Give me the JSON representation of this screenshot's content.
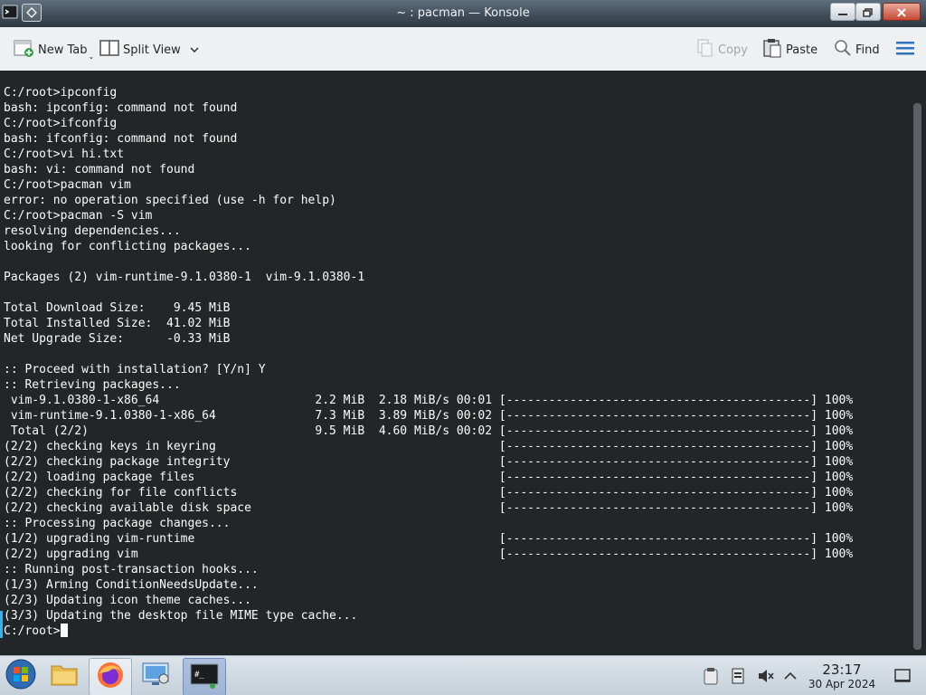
{
  "window": {
    "title": "~ : pacman — Konsole"
  },
  "toolbar": {
    "new_tab": "New Tab",
    "split_view": "Split View",
    "copy": "Copy",
    "paste": "Paste",
    "find": "Find"
  },
  "terminal": {
    "text": "C:/root>ipconfig\nbash: ipconfig: command not found\nC:/root>ifconfig\nbash: ifconfig: command not found\nC:/root>vi hi.txt\nbash: vi: command not found\nC:/root>pacman vim\nerror: no operation specified (use -h for help)\nC:/root>pacman -S vim\nresolving dependencies...\nlooking for conflicting packages...\n\nPackages (2) vim-runtime-9.1.0380-1  vim-9.1.0380-1\n\nTotal Download Size:    9.45 MiB\nTotal Installed Size:  41.02 MiB\nNet Upgrade Size:      -0.33 MiB\n\n:: Proceed with installation? [Y/n] Y\n:: Retrieving packages...\n vim-9.1.0380-1-x86_64                      2.2 MiB  2.18 MiB/s 00:01 [-------------------------------------------] 100%\n vim-runtime-9.1.0380-1-x86_64              7.3 MiB  3.89 MiB/s 00:02 [-------------------------------------------] 100%\n Total (2/2)                                9.5 MiB  4.60 MiB/s 00:02 [-------------------------------------------] 100%\n(2/2) checking keys in keyring                                        [-------------------------------------------] 100%\n(2/2) checking package integrity                                      [-------------------------------------------] 100%\n(2/2) loading package files                                           [-------------------------------------------] 100%\n(2/2) checking for file conflicts                                     [-------------------------------------------] 100%\n(2/2) checking available disk space                                   [-------------------------------------------] 100%\n:: Processing package changes...\n(1/2) upgrading vim-runtime                                           [-------------------------------------------] 100%\n(2/2) upgrading vim                                                   [-------------------------------------------] 100%\n:: Running post-transaction hooks...\n(1/3) Arming ConditionNeedsUpdate...\n(2/3) Updating icon theme caches...\n(3/3) Updating the desktop file MIME type cache...",
    "prompt": "C:/root>"
  },
  "taskbar": {
    "time": "23:17",
    "date": "30 Apr 2024"
  },
  "icons": {
    "app": "konsole-icon",
    "keep_above": "pin-icon",
    "minimize": "minimize-icon",
    "maximize": "maximize-icon",
    "close": "close-icon",
    "new_tab": "new-tab-icon",
    "split_view": "split-view-icon",
    "copy": "copy-icon",
    "paste": "paste-icon",
    "find": "search-icon",
    "menu": "hamburger-menu-icon",
    "start": "start-menu-icon",
    "files": "folder-icon",
    "browser": "firefox-icon",
    "settings": "control-panel-icon",
    "terminal": "terminal-icon",
    "clipboard": "clipboard-icon",
    "devices": "device-notifier-icon",
    "volume": "volume-muted-icon",
    "tray_expand": "chevron-up-icon",
    "show_desktop": "show-desktop-icon"
  },
  "colors": {
    "terminal_bg": "#232629",
    "terminal_fg": "#fcfcfc",
    "accent": "#3daee9"
  }
}
